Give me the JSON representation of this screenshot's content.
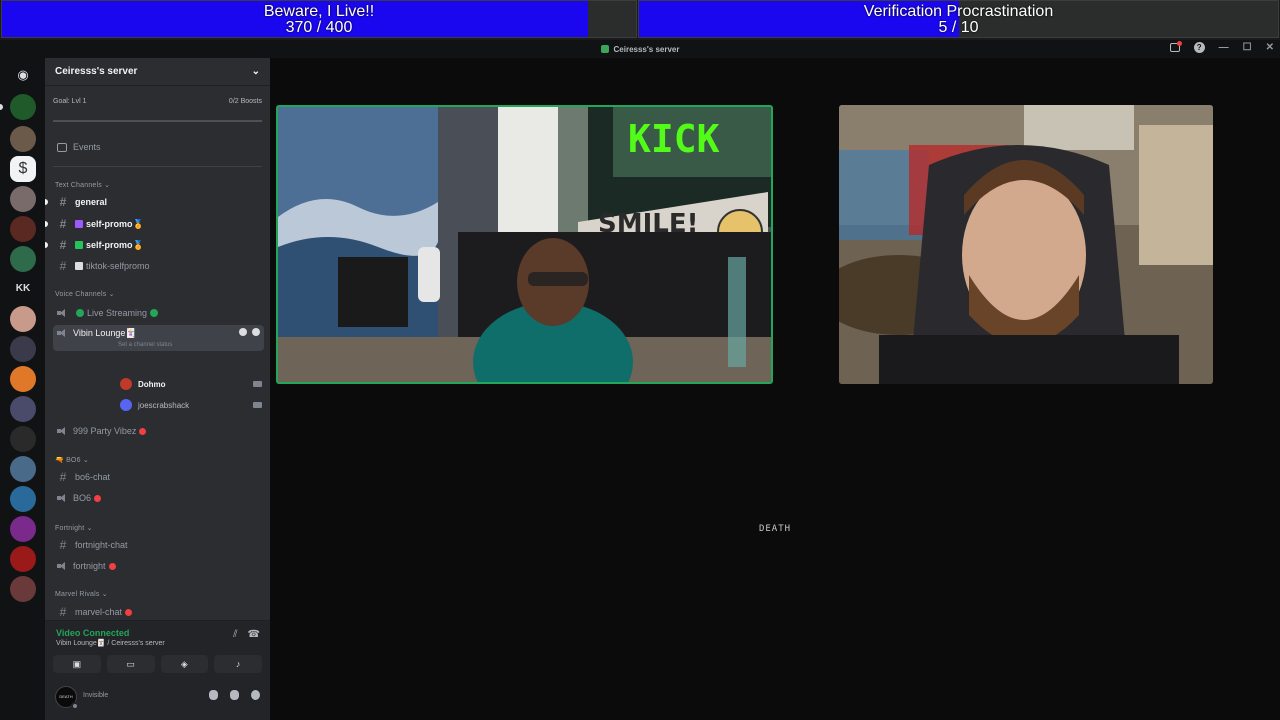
{
  "goals": [
    {
      "title": "Beware, I Live!!",
      "progress_text": "370 / 400",
      "current": 370,
      "target": 400,
      "fill_color": "#1a07f0"
    },
    {
      "title": "Verification Procrastination",
      "progress_text": "5 / 10",
      "current": 5,
      "target": 10,
      "fill_color": "#1a07f0"
    }
  ],
  "window": {
    "title": "Ceiresss's server"
  },
  "server": {
    "name": "Ceiresss's server",
    "boost_goal": "Goal: Lvl 1",
    "boost_count": "0/2 Boosts",
    "events_label": "Events"
  },
  "rail": {
    "kk_label": "KK",
    "s_label": "$"
  },
  "text_category": "Text Channels",
  "text_channels": [
    {
      "name": "general"
    },
    {
      "name": "self-promo",
      "emoji": "🏅"
    },
    {
      "name": "self-promo",
      "emoji": "🏅"
    },
    {
      "name": "tiktok-selfpromo"
    }
  ],
  "voice_category": "Voice Channels",
  "voice_channels": {
    "live_streaming": "Live Streaming",
    "vibin_lounge": "Vibin Lounge🃏",
    "set_status": "Set a channel status",
    "users": [
      {
        "name": "Dohmo"
      },
      {
        "name": "joescrabshack"
      }
    ],
    "party": "999 Party Vibez"
  },
  "bo6_category": "BO6",
  "bo6_channels": {
    "chat": "bo6-chat",
    "voice": "BO6"
  },
  "fortnite_category": "Fortnight",
  "fortnite_channels": {
    "chat": "fortnight-chat",
    "voice": "fortnight"
  },
  "marvel_category": "Marvel Rivals",
  "marvel_channels": {
    "chat": "marvel-chat"
  },
  "voice_panel": {
    "status": "Video Connected",
    "location": "Vibin Lounge🃏 / Ceiresss's server"
  },
  "user_panel": {
    "avatar_text": "DEATH",
    "status_text": "Invisible"
  },
  "stage": {
    "label": "DEATH"
  },
  "colors": {
    "accent_green": "#23a55a",
    "goal_fill": "#1a07f0",
    "sidebar_bg": "#2b2d31"
  }
}
